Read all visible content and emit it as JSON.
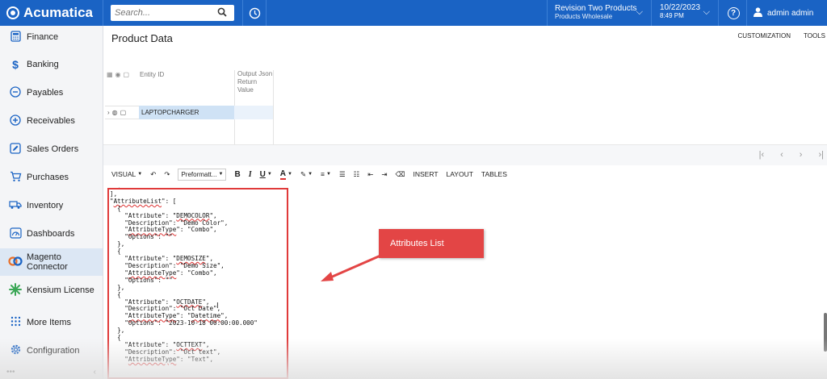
{
  "topbar": {
    "brand": "Acumatica",
    "search_placeholder": "Search...",
    "company_line1": "Revision Two Products",
    "company_line2": "Products Wholesale",
    "date": "10/22/2023",
    "time": "8:49 PM",
    "help_label": "?",
    "user": "admin admin"
  },
  "sidebar": {
    "items": [
      {
        "label": "Finance",
        "icon": "finance-icon"
      },
      {
        "label": "Banking",
        "icon": "dollar-icon"
      },
      {
        "label": "Payables",
        "icon": "minus-circle-icon"
      },
      {
        "label": "Receivables",
        "icon": "plus-circle-icon"
      },
      {
        "label": "Sales Orders",
        "icon": "pencil-icon"
      },
      {
        "label": "Purchases",
        "icon": "cart-icon"
      },
      {
        "label": "Inventory",
        "icon": "truck-icon"
      },
      {
        "label": "Dashboards",
        "icon": "gauge-icon"
      },
      {
        "label": "Magento Connector",
        "icon": "magento-icon"
      },
      {
        "label": "Kensium License",
        "icon": "kensium-icon"
      },
      {
        "label": "More Items",
        "icon": "grid-dots-icon"
      },
      {
        "label": "Configuration",
        "icon": "gear-icon"
      }
    ],
    "footer_dots": "•••",
    "footer_collapse": "‹"
  },
  "main": {
    "title": "Product Data",
    "links": [
      "CUSTOMIZATION",
      "TOOLS"
    ],
    "grid": {
      "col_entity": "Entity ID",
      "col_output": "Output Json Return Value",
      "row_value": "LAPTOPCHARGER"
    },
    "toolbar": {
      "visual": "VISUAL",
      "format": "Preformatt...",
      "bold": "B",
      "italic": "I",
      "underline": "U",
      "insert": "INSERT",
      "layout": "LAYOUT",
      "tables": "TABLES"
    },
    "callout": "Attributes List"
  },
  "editor_lines": [
    "  ,",
    "],",
    "\"AttributeList\": [",
    "  {",
    "    \"Attribute\": \"DEMOCOLOR\",",
    "    \"Description\": \"Demo Color\",",
    "    \"AttributeType\": \"Combo\",",
    "    \"Options\": \"\"",
    "  },",
    "  {",
    "    \"Attribute\": \"DEMOSIZE\",",
    "    \"Description\": \"Demo Size\",",
    "    \"AttributeType\": \"Combo\",",
    "    \"Options\": \"\"",
    "  },",
    "  {",
    "    \"Attribute\": \"OCTDATE\",",
    "    \"Description\": \"Oct Date\",",
    "    \"AttributeType\": \"Datetime\",",
    "    \"Options\": \"2023-10-18 00:00:00.000\"",
    "  },",
    "  {",
    "    \"Attribute\": \"OCTTEXT\",",
    "    \"Description\": \"Oct text\",",
    "    \"AttributeType\": \"Text\","
  ]
}
